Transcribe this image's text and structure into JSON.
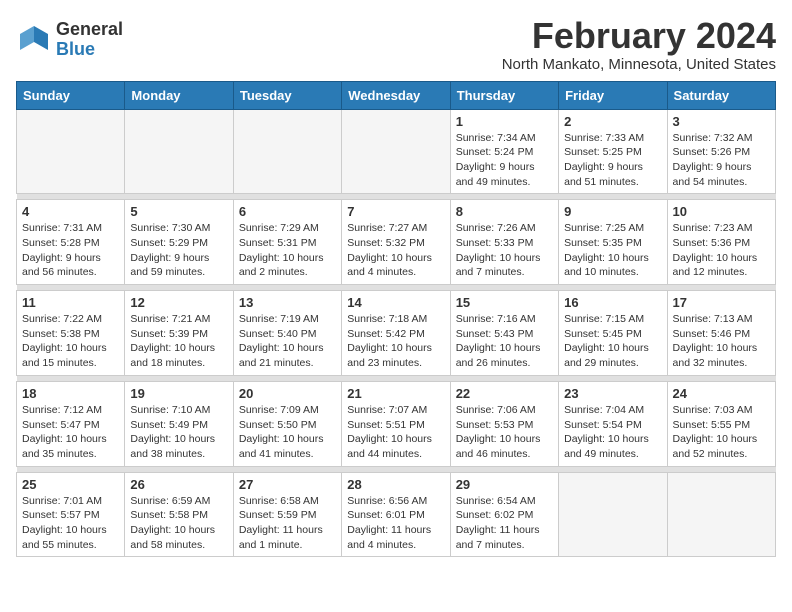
{
  "header": {
    "logo_general": "General",
    "logo_blue": "Blue",
    "month_year": "February 2024",
    "location": "North Mankato, Minnesota, United States"
  },
  "calendar": {
    "headers": [
      "Sunday",
      "Monday",
      "Tuesday",
      "Wednesday",
      "Thursday",
      "Friday",
      "Saturday"
    ],
    "rows": [
      [
        {
          "day": "",
          "detail": ""
        },
        {
          "day": "",
          "detail": ""
        },
        {
          "day": "",
          "detail": ""
        },
        {
          "day": "",
          "detail": ""
        },
        {
          "day": "1",
          "detail": "Sunrise: 7:34 AM\nSunset: 5:24 PM\nDaylight: 9 hours\nand 49 minutes."
        },
        {
          "day": "2",
          "detail": "Sunrise: 7:33 AM\nSunset: 5:25 PM\nDaylight: 9 hours\nand 51 minutes."
        },
        {
          "day": "3",
          "detail": "Sunrise: 7:32 AM\nSunset: 5:26 PM\nDaylight: 9 hours\nand 54 minutes."
        }
      ],
      [
        {
          "day": "4",
          "detail": "Sunrise: 7:31 AM\nSunset: 5:28 PM\nDaylight: 9 hours\nand 56 minutes."
        },
        {
          "day": "5",
          "detail": "Sunrise: 7:30 AM\nSunset: 5:29 PM\nDaylight: 9 hours\nand 59 minutes."
        },
        {
          "day": "6",
          "detail": "Sunrise: 7:29 AM\nSunset: 5:31 PM\nDaylight: 10 hours\nand 2 minutes."
        },
        {
          "day": "7",
          "detail": "Sunrise: 7:27 AM\nSunset: 5:32 PM\nDaylight: 10 hours\nand 4 minutes."
        },
        {
          "day": "8",
          "detail": "Sunrise: 7:26 AM\nSunset: 5:33 PM\nDaylight: 10 hours\nand 7 minutes."
        },
        {
          "day": "9",
          "detail": "Sunrise: 7:25 AM\nSunset: 5:35 PM\nDaylight: 10 hours\nand 10 minutes."
        },
        {
          "day": "10",
          "detail": "Sunrise: 7:23 AM\nSunset: 5:36 PM\nDaylight: 10 hours\nand 12 minutes."
        }
      ],
      [
        {
          "day": "11",
          "detail": "Sunrise: 7:22 AM\nSunset: 5:38 PM\nDaylight: 10 hours\nand 15 minutes."
        },
        {
          "day": "12",
          "detail": "Sunrise: 7:21 AM\nSunset: 5:39 PM\nDaylight: 10 hours\nand 18 minutes."
        },
        {
          "day": "13",
          "detail": "Sunrise: 7:19 AM\nSunset: 5:40 PM\nDaylight: 10 hours\nand 21 minutes."
        },
        {
          "day": "14",
          "detail": "Sunrise: 7:18 AM\nSunset: 5:42 PM\nDaylight: 10 hours\nand 23 minutes."
        },
        {
          "day": "15",
          "detail": "Sunrise: 7:16 AM\nSunset: 5:43 PM\nDaylight: 10 hours\nand 26 minutes."
        },
        {
          "day": "16",
          "detail": "Sunrise: 7:15 AM\nSunset: 5:45 PM\nDaylight: 10 hours\nand 29 minutes."
        },
        {
          "day": "17",
          "detail": "Sunrise: 7:13 AM\nSunset: 5:46 PM\nDaylight: 10 hours\nand 32 minutes."
        }
      ],
      [
        {
          "day": "18",
          "detail": "Sunrise: 7:12 AM\nSunset: 5:47 PM\nDaylight: 10 hours\nand 35 minutes."
        },
        {
          "day": "19",
          "detail": "Sunrise: 7:10 AM\nSunset: 5:49 PM\nDaylight: 10 hours\nand 38 minutes."
        },
        {
          "day": "20",
          "detail": "Sunrise: 7:09 AM\nSunset: 5:50 PM\nDaylight: 10 hours\nand 41 minutes."
        },
        {
          "day": "21",
          "detail": "Sunrise: 7:07 AM\nSunset: 5:51 PM\nDaylight: 10 hours\nand 44 minutes."
        },
        {
          "day": "22",
          "detail": "Sunrise: 7:06 AM\nSunset: 5:53 PM\nDaylight: 10 hours\nand 46 minutes."
        },
        {
          "day": "23",
          "detail": "Sunrise: 7:04 AM\nSunset: 5:54 PM\nDaylight: 10 hours\nand 49 minutes."
        },
        {
          "day": "24",
          "detail": "Sunrise: 7:03 AM\nSunset: 5:55 PM\nDaylight: 10 hours\nand 52 minutes."
        }
      ],
      [
        {
          "day": "25",
          "detail": "Sunrise: 7:01 AM\nSunset: 5:57 PM\nDaylight: 10 hours\nand 55 minutes."
        },
        {
          "day": "26",
          "detail": "Sunrise: 6:59 AM\nSunset: 5:58 PM\nDaylight: 10 hours\nand 58 minutes."
        },
        {
          "day": "27",
          "detail": "Sunrise: 6:58 AM\nSunset: 5:59 PM\nDaylight: 11 hours\nand 1 minute."
        },
        {
          "day": "28",
          "detail": "Sunrise: 6:56 AM\nSunset: 6:01 PM\nDaylight: 11 hours\nand 4 minutes."
        },
        {
          "day": "29",
          "detail": "Sunrise: 6:54 AM\nSunset: 6:02 PM\nDaylight: 11 hours\nand 7 minutes."
        },
        {
          "day": "",
          "detail": ""
        },
        {
          "day": "",
          "detail": ""
        }
      ]
    ]
  }
}
